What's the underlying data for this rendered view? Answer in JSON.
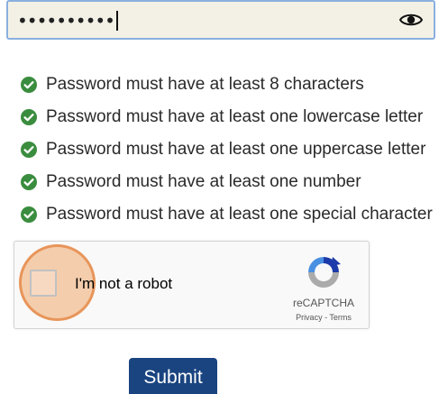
{
  "password_field": {
    "value": "••••••••••",
    "show_password_icon": "eye-icon"
  },
  "requirements": [
    {
      "text": "Password must have at least 8 characters",
      "met": true
    },
    {
      "text": "Password must have at least one lowercase letter",
      "met": true
    },
    {
      "text": "Password must have at least one uppercase letter",
      "met": true
    },
    {
      "text": "Password must have at least one number",
      "met": true
    },
    {
      "text": "Password must have at least one special character",
      "met": true
    }
  ],
  "recaptcha": {
    "label": "I'm not a robot",
    "checked": false,
    "brand": "reCAPTCHA",
    "privacy_link": "Privacy",
    "separator": " - ",
    "terms_link": "Terms"
  },
  "submit": {
    "label": "Submit"
  },
  "colors": {
    "check_green": "#3a8d3e",
    "submit_bg": "#1a4480",
    "field_bg": "#f3f1e6",
    "field_border": "#8bb0e0",
    "highlight": "#e8955a"
  }
}
